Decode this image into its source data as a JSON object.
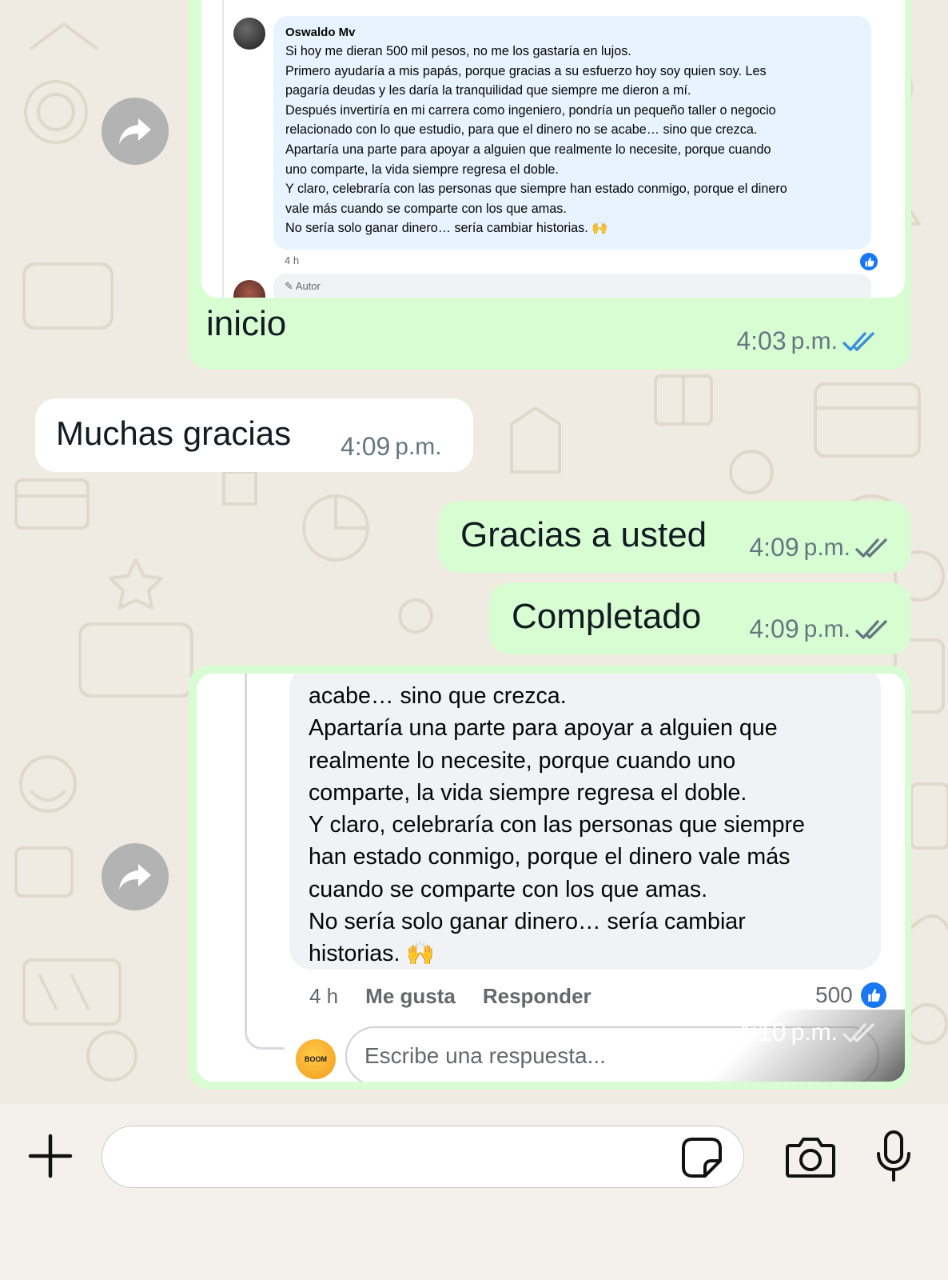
{
  "colors": {
    "chat_background": "#efeae2",
    "outgoing_bubble": "#d9fdd3",
    "incoming_bubble": "#ffffff",
    "read_ticks": "#3b8ed8",
    "delivered_ticks": "#667781",
    "facebook_blue": "#1877f2"
  },
  "messages": [
    {
      "direction": "outgoing",
      "type": "image",
      "forward_icon": "forward-arrow-icon",
      "image": {
        "commenter_name": "Oswaldo Mv",
        "comment_lines": [
          "Si hoy me dieran 500 mil pesos, no me los gastaría en lujos.",
          "Primero ayudaría a mis papás, porque gracias a su esfuerzo hoy soy quien soy. Les",
          "pagaría deudas y les daría la tranquilidad que siempre me dieron a mí.",
          "Después invertiría en mi carrera como ingeniero, pondría un pequeño taller o negocio",
          "relacionado con lo que estudio, para que el dinero no se acabe… sino que crezca.",
          "Apartaría una parte para apoyar a alguien que realmente lo necesite, porque cuando",
          "uno comparte, la vida siempre regresa el doble.",
          "Y claro, celebraría con las personas que siempre han estado conmigo, porque el dinero",
          "vale más cuando se comparte con los que amas.",
          "No sería solo ganar dinero… sería cambiar historias. 🙌"
        ],
        "comment_age": "4 h",
        "next_reply_label": "Autor",
        "like_icon": "thumbs-up-icon"
      },
      "caption": "inicio",
      "time": "4:03",
      "ampm": "p.m.",
      "status": "read"
    },
    {
      "direction": "incoming",
      "text": "Muchas gracias",
      "time": "4:09",
      "ampm": "p.m."
    },
    {
      "direction": "outgoing",
      "text": "Gracias a usted",
      "time": "4:09",
      "ampm": "p.m.",
      "status": "delivered"
    },
    {
      "direction": "outgoing",
      "text": "Completado",
      "time": "4:09",
      "ampm": "p.m.",
      "status": "delivered"
    },
    {
      "direction": "outgoing",
      "type": "image",
      "forward_icon": "forward-arrow-icon",
      "image": {
        "comment_lines": [
          "acabe… sino que crezca.",
          "Apartaría una parte para apoyar a alguien que",
          "realmente lo necesite, porque cuando uno",
          "comparte, la vida siempre regresa el doble.",
          "Y claro, celebraría con las personas que siempre",
          "han estado conmigo, porque el dinero vale más",
          "cuando se comparte con los que amas.",
          "No sería solo ganar dinero… sería cambiar",
          "historias. 🙌"
        ],
        "comment_age": "4 h",
        "like_action": "Me gusta",
        "reply_action": "Responder",
        "like_count": "500",
        "like_icon": "thumbs-up-icon",
        "avatar_text": "BOOM",
        "reply_placeholder": "Escribe una respuesta..."
      },
      "time": "4:10",
      "ampm": "p.m.",
      "status": "delivered"
    }
  ],
  "input_bar": {
    "attach_icon": "plus-icon",
    "text_value": "",
    "sticker_icon": "sticker-icon",
    "camera_icon": "camera-icon",
    "mic_icon": "microphone-icon"
  }
}
